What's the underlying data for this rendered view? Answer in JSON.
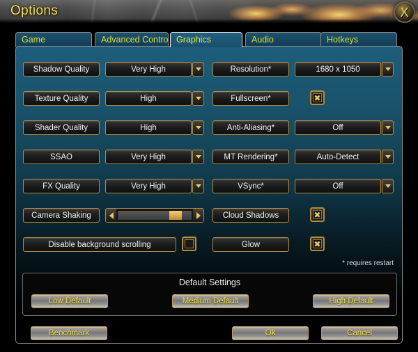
{
  "window": {
    "title": "Options",
    "close_label": "X"
  },
  "tabs": [
    {
      "label": "Game",
      "active": false
    },
    {
      "label": "Advanced Controls",
      "active": false
    },
    {
      "label": "Graphics",
      "active": true
    },
    {
      "label": "Audio",
      "active": false
    },
    {
      "label": "Hotkeys",
      "active": false
    }
  ],
  "settings": {
    "left_column": [
      {
        "label": "Shadow Quality",
        "control": "dropdown",
        "value": "Very High"
      },
      {
        "label": "Texture Quality",
        "control": "dropdown",
        "value": "High"
      },
      {
        "label": "Shader Quality",
        "control": "dropdown",
        "value": "High"
      },
      {
        "label": "SSAO",
        "control": "dropdown",
        "value": "Very High"
      },
      {
        "label": "FX Quality",
        "control": "dropdown",
        "value": "Very High"
      },
      {
        "label": "Camera Shaking",
        "control": "slider",
        "value": "85"
      }
    ],
    "right_column": [
      {
        "label": "Resolution*",
        "control": "dropdown",
        "value": "1680 x 1050"
      },
      {
        "label": "Fullscreen*",
        "control": "checkbox",
        "value": "checked"
      },
      {
        "label": "Anti-Aliasing*",
        "control": "dropdown",
        "value": "Off"
      },
      {
        "label": "MT Rendering*",
        "control": "dropdown",
        "value": "Auto-Detect"
      },
      {
        "label": "VSync*",
        "control": "dropdown",
        "value": "Off"
      },
      {
        "label": "Cloud Shadows",
        "control": "checkbox",
        "value": "checked"
      },
      {
        "label": "Glow",
        "control": "checkbox",
        "value": "checked"
      }
    ],
    "scrolling_row": {
      "label": "Disable background scrolling",
      "control": "checkbox",
      "value": "unchecked"
    },
    "footnote": "* requires restart",
    "checkbox_mark": "✖"
  },
  "defaults": {
    "title": "Default Settings",
    "low_label": "Low Default",
    "medium_label": "Medium Default",
    "high_label": "High Default"
  },
  "actions": {
    "benchmark_label": "Benchmark",
    "ok_label": "Ok",
    "cancel_label": "Cancel"
  },
  "colors": {
    "accent_gold": "#b08d42",
    "title_yellow": "#f2dc52",
    "tab_text": "#cfe03a",
    "button_yellow": "#f5e23c",
    "panel_teal": "#1d5e7c"
  }
}
